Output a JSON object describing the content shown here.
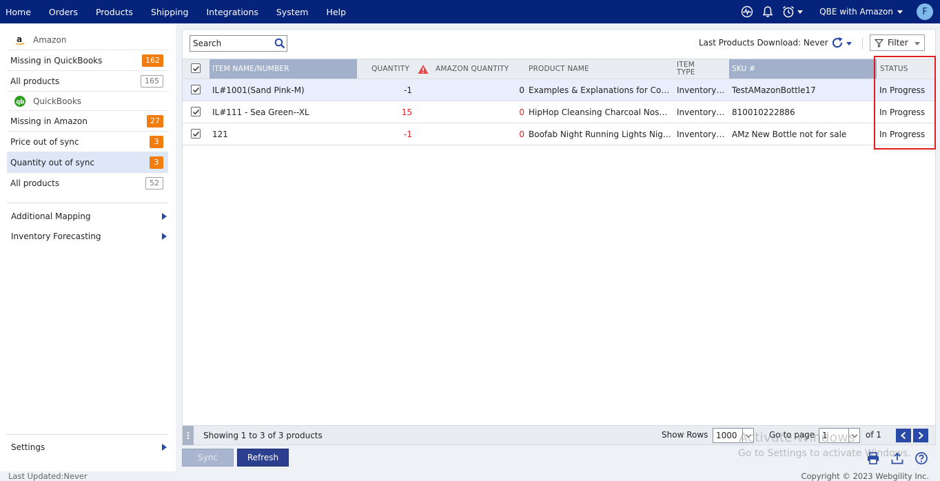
{
  "nav": {
    "items": [
      "Home",
      "Orders",
      "Products",
      "Shipping",
      "Integrations",
      "System",
      "Help"
    ],
    "company": "QBE with Amazon",
    "avatar_letter": "F"
  },
  "sidebar": {
    "amazon_heading": "Amazon",
    "amazon_items": [
      {
        "label": "Missing in QuickBooks",
        "count": "162",
        "style": "orange"
      },
      {
        "label": "All products",
        "count": "165",
        "style": "outline"
      }
    ],
    "qb_heading": "QuickBooks",
    "qb_items": [
      {
        "label": "Missing in Amazon",
        "count": "27",
        "style": "orange"
      },
      {
        "label": "Price out of sync",
        "count": "3",
        "style": "orange"
      },
      {
        "label": "Quantity out of sync",
        "count": "3",
        "style": "orange",
        "active": true
      },
      {
        "label": "All products",
        "count": "52",
        "style": "outline"
      }
    ],
    "additional_mapping": "Additional Mapping",
    "inventory_forecasting": "Inventory Forecasting",
    "settings": "Settings",
    "last_updated": "Last Updated:Never"
  },
  "toolbar": {
    "search_placeholder": "Search",
    "last_download": "Last Products Download: Never",
    "filter_label": "Filter"
  },
  "table": {
    "columns": {
      "item": "ITEM NAME/NUMBER",
      "quantity": "QUANTITY",
      "amazon_quantity": "AMAZON QUANTITY",
      "product_name": "PRODUCT NAME",
      "item_type_1": "ITEM",
      "item_type_2": "TYPE",
      "sku": "SKU #",
      "status": "STATUS"
    },
    "rows": [
      {
        "item": "IL#1001(Sand Pink-M)",
        "quantity": "-1",
        "qty_red": false,
        "amazon_quantity": "0",
        "aq_red": false,
        "product_name": "Examples & Explanations for Contracts",
        "item_type": "Inventory Part",
        "sku": "TestAMazonBottle17",
        "status": "In Progress",
        "selected": true
      },
      {
        "item": "IL#111 - Sea Green--XL",
        "quantity": "15",
        "qty_red": true,
        "amazon_quantity": "0",
        "aq_red": true,
        "product_name": "HipHop Cleansing Charcoal Nose Strips",
        "item_type": "Inventory Part",
        "sku": "810010222886",
        "status": "In Progress",
        "selected": false
      },
      {
        "item": "121",
        "quantity": "-1",
        "qty_red": true,
        "amazon_quantity": "0",
        "aq_red": true,
        "product_name": "Boofab Night Running Lights Night Lights",
        "item_type": "Inventory Part",
        "sku": "AMz New Bottle not for sale",
        "status": "In Progress",
        "selected": false
      }
    ]
  },
  "pager": {
    "showing": "Showing 1 to 3 of 3 products",
    "show_rows_label": "Show Rows",
    "rows_value": "1000",
    "goto_label": "Go to page",
    "page_value": "1",
    "of_label": "of 1"
  },
  "buttons": {
    "sync": "Sync",
    "refresh": "Refresh"
  },
  "watermark": {
    "line1": "Activate Windows",
    "line2": "Go to Settings to activate Windows."
  },
  "copyright": "Copyright © 2023 Webgility Inc.",
  "colors": {
    "nav_bg": "#06237c",
    "badge_orange": "#f27d0c",
    "header_blue": "#a2b0cc",
    "refresh_btn": "#2c3f8f",
    "highlight_red": "#e01b1b"
  }
}
